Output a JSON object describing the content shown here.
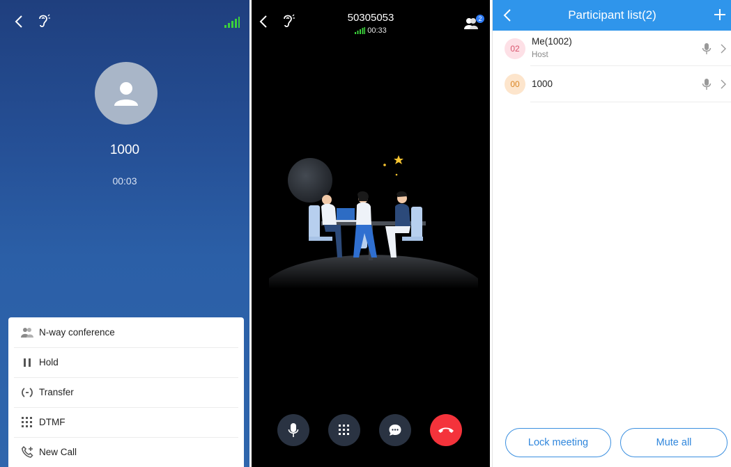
{
  "call_screen": {
    "caller_name": "1000",
    "duration": "00:03",
    "menu": [
      {
        "label": "N-way conference",
        "icon": "conference-icon"
      },
      {
        "label": "Hold",
        "icon": "pause-icon"
      },
      {
        "label": "Transfer",
        "icon": "transfer-icon"
      },
      {
        "label": "DTMF",
        "icon": "dialpad-icon"
      },
      {
        "label": "New Call",
        "icon": "new-call-icon"
      }
    ]
  },
  "conference_screen": {
    "number": "50305053",
    "duration": "00:33",
    "participant_badge": "2",
    "controls": [
      {
        "icon": "mic-icon"
      },
      {
        "icon": "dialpad-icon"
      },
      {
        "icon": "chat-icon"
      },
      {
        "icon": "hangup-icon"
      }
    ]
  },
  "participant_screen": {
    "title": "Participant list(2)",
    "participants": [
      {
        "avatar": "02",
        "name": "Me(1002)",
        "role": "Host",
        "avatar_color": "#fde0e6",
        "avatar_text_color": "#d9546d"
      },
      {
        "avatar": "00",
        "name": "1000",
        "role": "",
        "avatar_color": "#fde5cc",
        "avatar_text_color": "#d98524"
      }
    ],
    "lock_label": "Lock meeting",
    "mute_label": "Mute all"
  },
  "colors": {
    "header_blue": "#2f95eb",
    "hangup_red": "#f4333b",
    "signal_green": "#3bd13b",
    "button_blue": "#2f86dc"
  }
}
